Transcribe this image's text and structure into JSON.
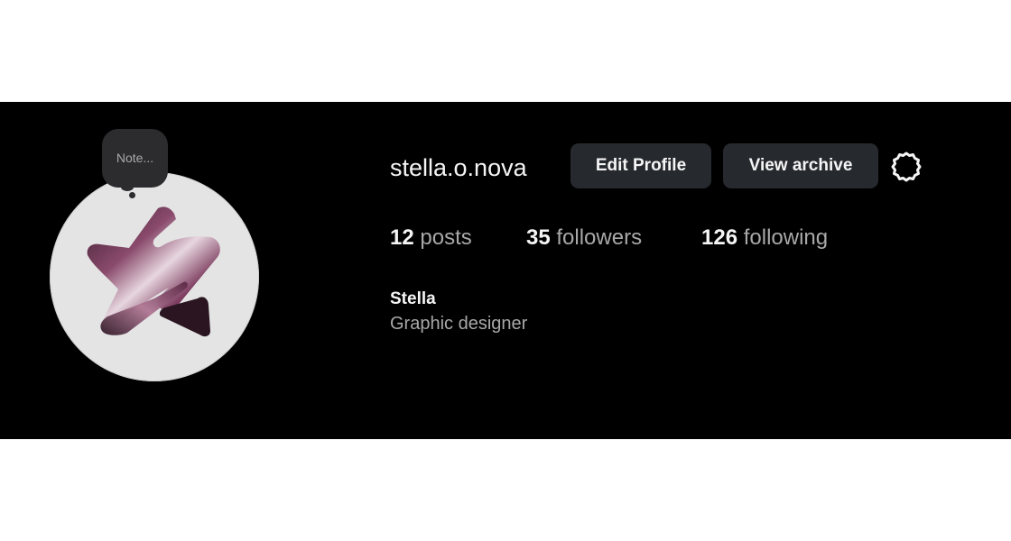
{
  "note": {
    "text": "Note..."
  },
  "profile": {
    "username": "stella.o.nova",
    "full_name": "Stella",
    "bio": "Graphic designer",
    "avatar_icon": "star-logo-avatar"
  },
  "actions": {
    "edit_label": "Edit Profile",
    "archive_label": "View archive",
    "settings_icon": "gear-icon"
  },
  "stats": {
    "posts_count": "12",
    "posts_label": "posts",
    "followers_count": "35",
    "followers_label": "followers",
    "following_count": "126",
    "following_label": "following"
  },
  "colors": {
    "banner_bg": "#000000",
    "button_bg": "#26292e",
    "text_primary": "#f5f5f5",
    "text_secondary": "#a8a8a8",
    "avatar_bg": "#e4e4e4"
  }
}
